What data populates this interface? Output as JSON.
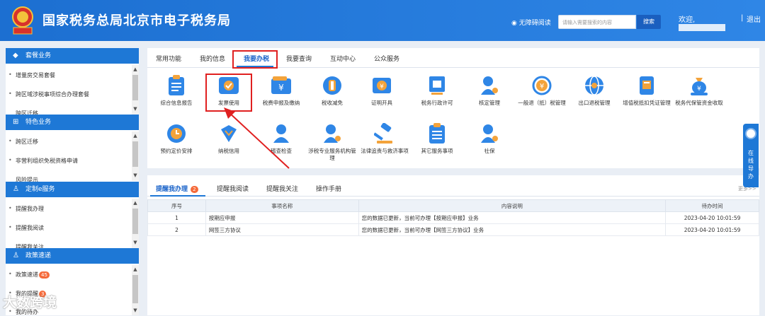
{
  "header": {
    "title": "国家税务总局北京市电子税务局",
    "accessibility": "无障碍阅读",
    "search_placeholder": "请输入需要搜索的内容",
    "search_button": "搜索",
    "welcome": "欢迎,",
    "separator": "|",
    "logout": "退出"
  },
  "sidebar": {
    "sections": [
      {
        "title": "套餐业务",
        "icon": "package-icon",
        "items": [
          "增量房交易套餐",
          "跨区域涉税事项综合办理套餐",
          "跨区迁移"
        ]
      },
      {
        "title": "特色业务",
        "icon": "grid-icon",
        "items": [
          "跨区迁移",
          "非营利组织免税资格申请",
          "风险提示"
        ]
      },
      {
        "title": "定制e服务",
        "icon": "user-icon",
        "items": [
          "提醒我办理",
          "提醒我阅读",
          "提醒我关注"
        ]
      },
      {
        "title": "政策速递",
        "icon": "user-icon",
        "items": [
          "政策速递",
          "我的提醒",
          "我的待办"
        ],
        "badges": [
          "45",
          "3",
          ""
        ]
      }
    ]
  },
  "main_tabs": [
    "常用功能",
    "我的信息",
    "我要办税",
    "我要查询",
    "互动中心",
    "公众服务"
  ],
  "active_tab": "我要办税",
  "services_row1": [
    "综合信息报告",
    "发票使用",
    "税费申报及缴纳",
    "税收减免",
    "证明开具",
    "税务行政许可",
    "核定管理",
    "一般退（抵）税管理",
    "出口退税管理",
    "增值税抵扣凭证管理",
    "税务代保管资金收取"
  ],
  "services_row2": [
    "预约定价安排",
    "纳税信用",
    "稽查检查",
    "涉税专业服务机构管理",
    "法律追责与救济事项",
    "其它服务事项",
    "社保"
  ],
  "highlighted_service": "发票使用",
  "bottom_tabs": {
    "t1": "提醒我办理",
    "t1_badge": "2",
    "t2": "提醒我阅读",
    "t3": "提醒我关注",
    "t4": "操作手册",
    "more": "更多>>"
  },
  "table": {
    "headers": [
      "序号",
      "事项名称",
      "内容说明",
      "待办时间"
    ],
    "rows": [
      [
        "1",
        "按期应申报",
        "您的数据已更新，当前可办理【按期应申报】业务",
        "2023-04-20 10:01:59"
      ],
      [
        "2",
        "网签三方协议",
        "您的数据已更新，当前可办理【网签三方协议】业务",
        "2023-04-20 10:01:59"
      ]
    ]
  },
  "side_tab": {
    "label": "在线导办"
  },
  "watermark": "大数跨境",
  "colors": {
    "brand_blue": "#1e78d6",
    "highlight_red": "#e02020",
    "badge_orange": "#f56a3a"
  }
}
